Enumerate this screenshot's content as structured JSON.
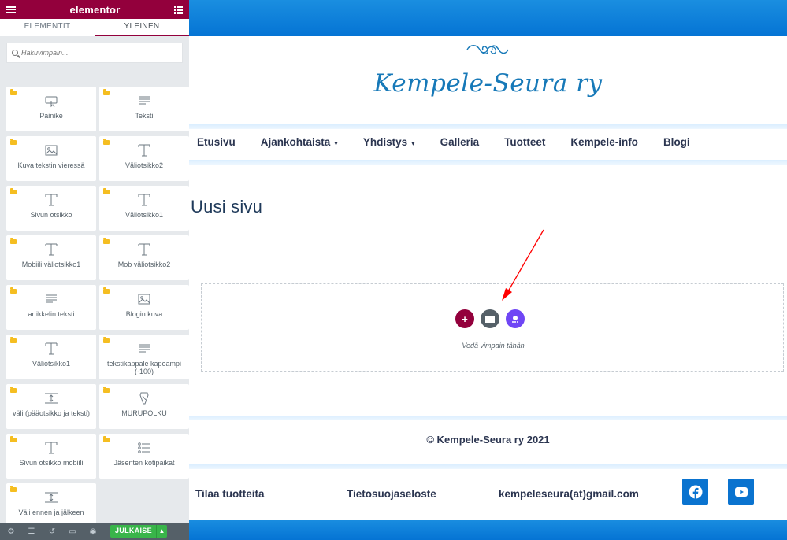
{
  "panel": {
    "brand": "elementor",
    "tabs": [
      {
        "label": "ELEMENTIT"
      },
      {
        "label": "YLEINEN"
      }
    ],
    "search_placeholder": "Hakuvimpain...",
    "widgets": [
      {
        "label": "Painike",
        "icon": "button-icon"
      },
      {
        "label": "Teksti",
        "icon": "text-lines-icon"
      },
      {
        "label": "Kuva tekstin vieressä",
        "icon": "image-icon"
      },
      {
        "label": "Väliotsikko2",
        "icon": "heading-icon"
      },
      {
        "label": "Sivun otsikko",
        "icon": "heading-icon"
      },
      {
        "label": "Väliotsikko1",
        "icon": "heading-icon"
      },
      {
        "label": "Mobiili väliotsikko1",
        "icon": "heading-icon"
      },
      {
        "label": "Mob väliotsikko2",
        "icon": "heading-icon"
      },
      {
        "label": "artikkelin teksti",
        "icon": "text-lines-icon"
      },
      {
        "label": "Blogin kuva",
        "icon": "image-icon"
      },
      {
        "label": "Väliotsikko1",
        "icon": "heading-icon"
      },
      {
        "label": "tekstikappale kapeampi (-100)",
        "icon": "text-lines-icon"
      },
      {
        "label": "väli (pääotsikko ja teksti)",
        "icon": "spacer-icon"
      },
      {
        "label": "MURUPOLKU",
        "icon": "breadcrumb-icon"
      },
      {
        "label": "Sivun otsikko mobiili",
        "icon": "heading-icon"
      },
      {
        "label": "Jäsenten kotipaikat",
        "icon": "list-icon"
      },
      {
        "label": "Väli ennen ja jälkeen",
        "icon": "spacer-icon"
      }
    ],
    "footer": {
      "publish_label": "JULKAISE",
      "icons": [
        "settings-icon",
        "layers-icon",
        "history-icon",
        "responsive-icon",
        "preview-icon"
      ]
    }
  },
  "site": {
    "title": "Kempele-Seura ry",
    "nav": [
      {
        "label": "Etusivu",
        "has_dropdown": false
      },
      {
        "label": "Ajankohtaista",
        "has_dropdown": true
      },
      {
        "label": "Yhdistys",
        "has_dropdown": true
      },
      {
        "label": "Galleria",
        "has_dropdown": false
      },
      {
        "label": "Tuotteet",
        "has_dropdown": false
      },
      {
        "label": "Kempele-info",
        "has_dropdown": false
      },
      {
        "label": "Blogi",
        "has_dropdown": false
      }
    ],
    "nav_caret": "▾",
    "page_heading": "Uusi sivu",
    "drop_zone_hint": "Vedä vimpain tähän",
    "copyright": "© Kempele-Seura ry 2021",
    "footer_links": [
      {
        "label": "Tilaa tuotteita"
      },
      {
        "label": "Tietosuojaseloste"
      },
      {
        "label": "kempeleseura(at)gmail.com"
      }
    ],
    "social": [
      {
        "name": "facebook-icon"
      },
      {
        "name": "youtube-icon"
      }
    ]
  },
  "colors": {
    "elementor_brand": "#93003c",
    "site_blue": "#0a73cf",
    "add_section": "#93003c",
    "add_template": "#556068",
    "add_ai": "#6f46f5",
    "publish_green": "#39b54a",
    "annotation_arrow": "#ff0000"
  }
}
